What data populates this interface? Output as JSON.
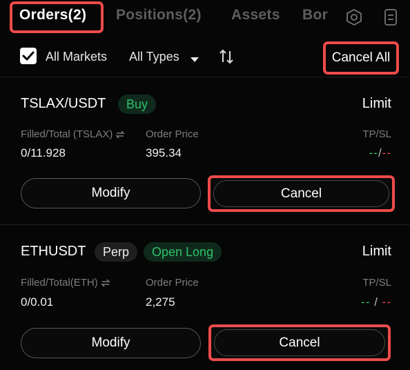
{
  "tabs": [
    {
      "label": "Orders(2)",
      "active": true
    },
    {
      "label": "Positions(2)",
      "active": false
    },
    {
      "label": "Assets",
      "active": false
    },
    {
      "label": "Bor",
      "active": false
    }
  ],
  "header_icons": [
    "settings-hexagon-icon",
    "document-icon"
  ],
  "filters": {
    "all_markets_label": "All Markets",
    "all_markets_checked": true,
    "types_label": "All Types",
    "cancel_all_label": "Cancel All"
  },
  "colors": {
    "buy_green": "#2ec26a",
    "sell_red": "#ee4b4b",
    "highlight_red": "#ee4b4b",
    "muted_label": "#7e7e7e"
  },
  "orders": [
    {
      "symbol": "TSLAX/USDT",
      "badges": [
        "Buy"
      ],
      "order_type": "Limit",
      "filled_label": "Filled/Total (TSLAX)",
      "filled_value": "0/11.928",
      "price_label": "Order Price",
      "price_value": "395.34",
      "tpsl_label": "TP/SL",
      "tp": "--",
      "separator": "/",
      "sl": "--",
      "modify_label": "Modify",
      "cancel_label": "Cancel"
    },
    {
      "symbol": "ETHUSDT",
      "badges": [
        "Perp",
        "Open Long"
      ],
      "order_type": "Limit",
      "filled_label": "Filled/Total(ETH)",
      "filled_value": "0/0.01",
      "price_label": "Order Price",
      "price_value": "2,275",
      "tpsl_label": "TP/SL",
      "tp": "--",
      "separator": " / ",
      "sl": "--",
      "modify_label": "Modify",
      "cancel_label": "Cancel"
    }
  ]
}
